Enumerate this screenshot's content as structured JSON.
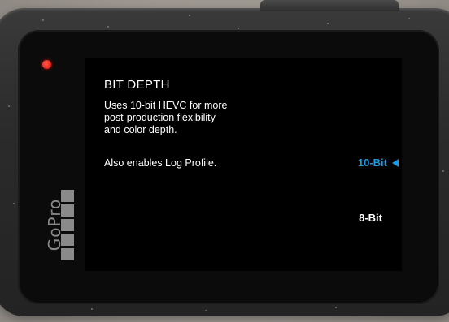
{
  "colors": {
    "accent": "#1a9be6",
    "text": "#ffffff",
    "recording_light": "#e8221a"
  },
  "device": {
    "logo_text": "GoPro"
  },
  "menu": {
    "title": "BIT DEPTH",
    "description": "Uses 10-bit HEVC for more\npost-production flexibility\nand color depth.",
    "note": "Also enables Log Profile.",
    "options": [
      {
        "label": "10-Bit",
        "selected": true,
        "selector_icon": "caret-left-icon"
      },
      {
        "label": "8-Bit",
        "selected": false
      }
    ]
  }
}
